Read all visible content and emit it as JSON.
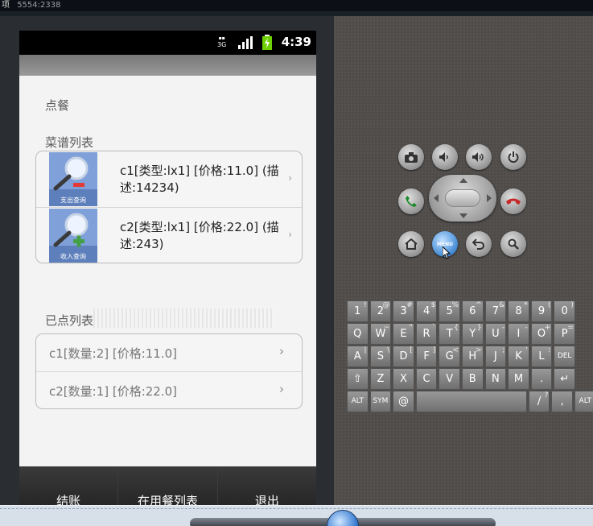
{
  "window": {
    "title_fragment": "5554:2338",
    "title_left_char": "项"
  },
  "status_bar": {
    "time": "4:39",
    "network": "3G"
  },
  "app": {
    "title": "点餐",
    "menu_section_label": "菜谱列表",
    "menu_items": [
      {
        "text": "c1[类型:lx1] [价格:11.0] (描述:14234)",
        "thumb_caption": "支出查询",
        "thumb_icon": "search-minus-icon"
      },
      {
        "text": "c2[类型:lx1] [价格:22.0] (描述:243)",
        "thumb_caption": "收入查询",
        "thumb_icon": "search-plus-icon"
      }
    ],
    "ordered_section_label": "已点列表",
    "ordered_items": [
      {
        "text": "c1[数量:2] [价格:11.0]"
      },
      {
        "text": "c2[数量:1] [价格:22.0]"
      }
    ],
    "bottom_buttons": [
      "结账",
      "在用餐列表",
      "退出"
    ]
  },
  "emulator_controls": {
    "top_row": [
      "camera-icon",
      "volume-down-icon",
      "volume-up-icon",
      "power-icon"
    ],
    "call_button": "call-icon",
    "end_call_button": "end-call-icon",
    "home_button": "home-icon",
    "menu_button_label": "MENU",
    "back_button": "back-icon",
    "search_button": "search-icon"
  },
  "keyboard": {
    "row1": [
      {
        "k": "1",
        "s": "!"
      },
      {
        "k": "2",
        "s": "@"
      },
      {
        "k": "3",
        "s": "#"
      },
      {
        "k": "4",
        "s": "$"
      },
      {
        "k": "5",
        "s": "%"
      },
      {
        "k": "6",
        "s": "^"
      },
      {
        "k": "7",
        "s": "&"
      },
      {
        "k": "8",
        "s": "*"
      },
      {
        "k": "9",
        "s": "("
      },
      {
        "k": "0",
        "s": ")"
      }
    ],
    "row2": [
      {
        "k": "Q",
        "s": ""
      },
      {
        "k": "W",
        "s": "~"
      },
      {
        "k": "E",
        "s": "\""
      },
      {
        "k": "R",
        "s": "`"
      },
      {
        "k": "T",
        "s": "{"
      },
      {
        "k": "Y",
        "s": "}"
      },
      {
        "k": "U",
        "s": "-"
      },
      {
        "k": "I",
        "s": "-"
      },
      {
        "k": "O",
        "s": "+"
      },
      {
        "k": "P",
        "s": "="
      }
    ],
    "row3": [
      {
        "k": "A",
        "s": "|"
      },
      {
        "k": "S",
        "s": "\\"
      },
      {
        "k": "D",
        "s": "["
      },
      {
        "k": "F",
        "s": "]"
      },
      {
        "k": "G",
        "s": "<"
      },
      {
        "k": "H",
        "s": ">"
      },
      {
        "k": "J",
        "s": ";"
      },
      {
        "k": "K",
        "s": "'"
      },
      {
        "k": "L",
        "s": ":"
      },
      {
        "k": "DEL",
        "s": ""
      }
    ],
    "row4": [
      {
        "k": "⇧",
        "s": ""
      },
      {
        "k": "Z",
        "s": ""
      },
      {
        "k": "X",
        "s": ""
      },
      {
        "k": "C",
        "s": ""
      },
      {
        "k": "V",
        "s": ""
      },
      {
        "k": "B",
        "s": ""
      },
      {
        "k": "N",
        "s": ""
      },
      {
        "k": "M",
        "s": ""
      },
      {
        "k": ".",
        "s": ""
      },
      {
        "k": "↵",
        "s": ""
      }
    ],
    "row5": [
      {
        "k": "ALT",
        "s": ""
      },
      {
        "k": "SYM",
        "s": ""
      },
      {
        "k": "@",
        "s": ""
      },
      {
        "k": "",
        "s": ""
      },
      {
        "k": "/",
        "s": "?"
      },
      {
        "k": ",",
        "s": ""
      },
      {
        "k": "ALT",
        "s": ""
      }
    ]
  }
}
